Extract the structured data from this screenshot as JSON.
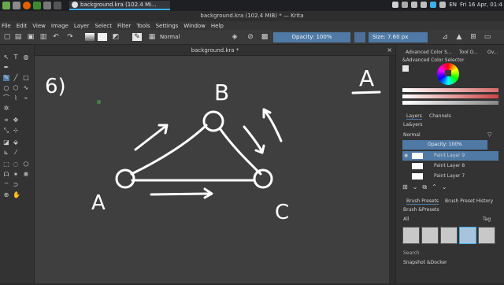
{
  "taskbar": {
    "task_title": "background.kra (102.4 Mi...",
    "window_title": "background.kra (102.4 MiB) * — Krita",
    "clock": "Fri 16 Apr, 01:4",
    "lang": "EN"
  },
  "menu": [
    "File",
    "Edit",
    "View",
    "Image",
    "Layer",
    "Select",
    "Filter",
    "Tools",
    "Settings",
    "Window",
    "Help"
  ],
  "toolbar": {
    "blend_mode": "Normal",
    "opacity": "Opacity: 100%",
    "size": "Size: 7.60 px"
  },
  "canvas": {
    "tab_title": "background.kra *",
    "labels": {
      "a": "A",
      "b": "B",
      "c": "C",
      "problem": "6)",
      "corner": "A"
    }
  },
  "docker": {
    "tabs_top": [
      "Advanced Color S...",
      "Tool O...",
      "Ov..."
    ],
    "color_selector_title": "&Advanced Color Selector",
    "layers_tabs": [
      "Layers",
      "Channels"
    ],
    "layers_title": "La&yers",
    "layers_blend": "Normal",
    "layers_opacity": "Opacity: 100%",
    "layers": [
      "Paint Layer 9",
      "Paint Layer 8",
      "Paint Layer 7"
    ],
    "brush_tabs": [
      "Brush Presets",
      "Brush Preset History"
    ],
    "brush_title": "Brush &Presets",
    "brush_filter": "All",
    "brush_tag": "Tag",
    "search": "Search",
    "snapshot": "Snapshot &Docker"
  },
  "colors": {
    "accent": "#4f7aa6",
    "canvas": "#3f3f3f",
    "ink": "#ffffff"
  }
}
